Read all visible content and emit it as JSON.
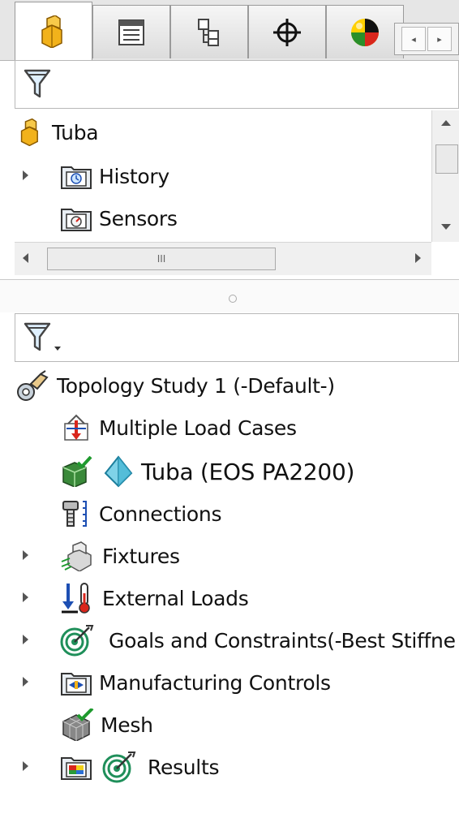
{
  "tabs": [
    {
      "name": "featuremanager-tab",
      "icon": "part-icon",
      "active": true
    },
    {
      "name": "propertymanager-tab",
      "icon": "property-list-icon",
      "active": false
    },
    {
      "name": "configurationmanager-tab",
      "icon": "configuration-icon",
      "active": false
    },
    {
      "name": "dimxpert-tab",
      "icon": "crosshair-icon",
      "active": false
    },
    {
      "name": "display-manager-tab",
      "icon": "color-sphere-icon",
      "active": false
    }
  ],
  "feature_tree": {
    "root": {
      "label": "Tuba",
      "icon": "part-icon"
    },
    "items": [
      {
        "label": "History",
        "icon": "history-folder-icon",
        "expandable": true
      },
      {
        "label": "Sensors",
        "icon": "sensors-folder-icon",
        "expandable": false
      }
    ],
    "hscroll_grip": "III"
  },
  "study_tree": {
    "root": {
      "label": "Topology Study 1 (-Default-)",
      "icon": "topology-study-icon"
    },
    "items": [
      {
        "label": "Multiple Load Cases",
        "icon": "load-cases-icon",
        "expandable": false
      },
      {
        "label": "Tuba (EOS PA2200)",
        "icon": "solid-body-icon",
        "expandable": false
      },
      {
        "label": "Connections",
        "icon": "connections-icon",
        "expandable": false
      },
      {
        "label": "Fixtures",
        "icon": "fixtures-icon",
        "expandable": true
      },
      {
        "label": "External Loads",
        "icon": "external-loads-icon",
        "expandable": true
      },
      {
        "label": "Goals and Constraints(-Best Stiffne",
        "icon": "goals-target-icon",
        "expandable": true
      },
      {
        "label": "Manufacturing Controls",
        "icon": "manufacturing-controls-icon",
        "expandable": true
      },
      {
        "label": "Mesh",
        "icon": "mesh-icon",
        "expandable": false
      },
      {
        "label": "Results",
        "icon": "results-folder-icon",
        "expandable": true
      }
    ]
  },
  "colors": {
    "accent_yellow": "#f2b21b",
    "check_green": "#1f9a2e",
    "arrow_red": "#d9261c",
    "load_blue": "#1d4fb3"
  }
}
